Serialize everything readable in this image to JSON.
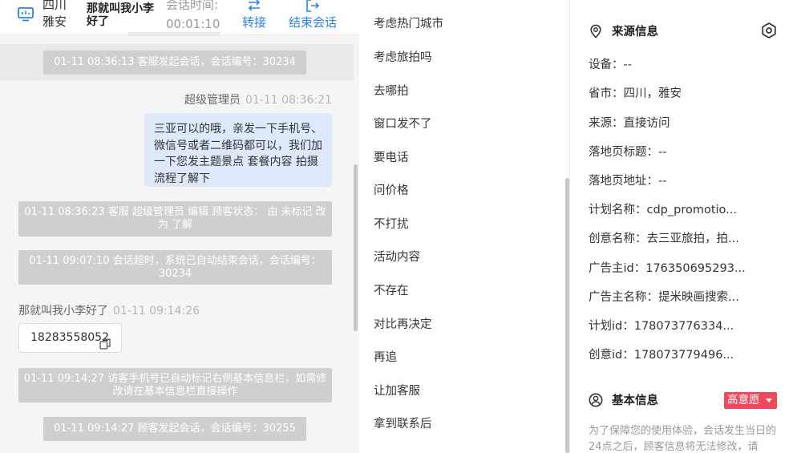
{
  "header": {
    "location_line1": "四川",
    "location_line2": "雅安",
    "visitor_name": "那就叫我小李好了",
    "session_time_label": "会话时间:",
    "session_time_value": "00:01:10",
    "transfer_label": "转接",
    "end_session_label": "结束会话"
  },
  "chat": {
    "messages": [
      {
        "kind": "system",
        "text": "01-11 08:36:13 客服发起会话，会话编号：30234"
      },
      {
        "kind": "agent",
        "sender": "超级管理员",
        "time": "01-11 08:36:21",
        "text": "三亚可以的哦，亲发一下手机号、微信号或者二维码都可以，我们加一下您发主题景点 套餐内容 拍摄流程了解下"
      },
      {
        "kind": "system",
        "text": "01-11 08:36:23 客服 超级管理员 编辑 顾客状态： 由 未标记 改为 了解"
      },
      {
        "kind": "system",
        "text": "01-11 09:07:10 会话超时，系统已自动结束会话，会话编号：30234"
      },
      {
        "kind": "visitor",
        "sender": "那就叫我小李好了",
        "time": "01-11 09:14:26",
        "text": "18283558052"
      },
      {
        "kind": "system",
        "text": "01-11 09:14:27 访客手机号已自动标记右侧基本信息栏，如需修改请在基本信息栏直接操作"
      },
      {
        "kind": "system",
        "text": "01-11 09:14:27 顾客发起会话，会话编号：30255"
      }
    ]
  },
  "quick_replies": [
    "考虑热门城市",
    "考虑旅拍吗",
    "去哪拍",
    "窗口发不了",
    "要电话",
    "问价格",
    "不打扰",
    "活动内容",
    "不存在",
    "对比再决定",
    "再追",
    "让加客服",
    "拿到联系后"
  ],
  "source_info": {
    "title": "来源信息",
    "rows": [
      "设备：--",
      "省市：四川，雅安",
      "来源：直接访问",
      "落地页标题：--",
      "落地页地址：--",
      "计划名称：cdp_promotio...",
      "创意名称：去三亚旅拍，拍...",
      "广告主id：176350695293...",
      "广告主名称：提米映画搜索...",
      "计划id：178073776334...",
      "创意id：178073779496..."
    ]
  },
  "basic_info": {
    "title": "基本信息",
    "intent_badge": "高意愿",
    "notice": "为了保障您的使用体验，会话发生当日的24点之后，顾客信息将无法修改，请"
  },
  "colors": {
    "accent": "#2a84e8",
    "agent_bubble": "#dde9fb",
    "system_pill": "#cfcfcf",
    "badge": "#f0485d"
  }
}
